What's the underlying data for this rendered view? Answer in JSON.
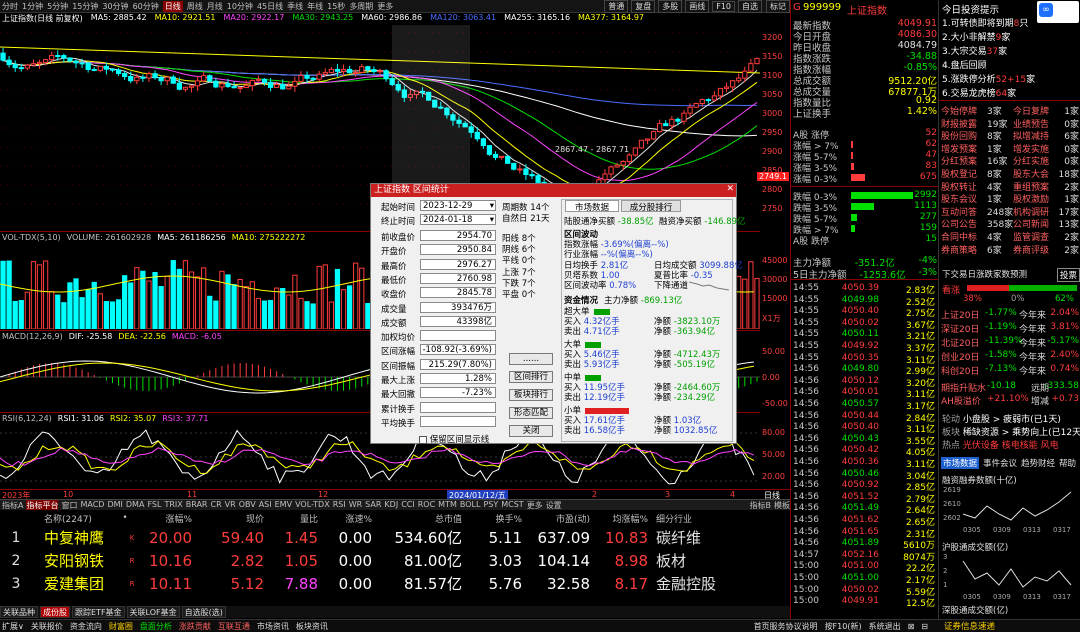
{
  "topbar": {
    "periods": [
      "分时",
      "1分钟",
      "5分钟",
      "15分钟",
      "30分钟",
      "60分钟",
      "日线",
      "周线",
      "月线",
      "10分钟",
      "45日线",
      "季线",
      "年线",
      "15秒",
      "多周期",
      "更多"
    ],
    "active_period": "日线",
    "tools": [
      "普通",
      "复盘",
      "多股",
      "画线",
      "F10",
      "自选"
    ],
    "back_label": "标记"
  },
  "chart_header": {
    "index_name": "上证指数(日线 前复权)",
    "ma": [
      {
        "label": "MA5: 2885.42",
        "color": "#ffffff"
      },
      {
        "label": "MA10: 2921.51",
        "color": "#ffff00"
      },
      {
        "label": "MA20: 2922.17",
        "color": "#ff44ff"
      },
      {
        "label": "MA30: 2943.25",
        "color": "#00e000"
      },
      {
        "label": "MA60: 2986.86",
        "color": "#ffffff"
      },
      {
        "label": "MA120: 3063.41",
        "color": "#4a6cff"
      },
      {
        "label": "MA255: 3165.16",
        "color": "#ffffff"
      },
      {
        "label": "MA377: 3164.97",
        "color": "#ffff00"
      }
    ]
  },
  "price_axis": [
    "3200",
    "3150",
    "3100",
    "3050",
    "3000",
    "2950",
    "2900",
    "2850",
    "2800",
    "2750"
  ],
  "price_current": "2749.1",
  "annotation": "2867.47 - 2867.71",
  "vol_header": {
    "name": "VOL-TDX(5,10)",
    "items": [
      {
        "label": "VOLUME: 261602928",
        "color": "#c0c0c0"
      },
      {
        "label": "MA5: 261186256",
        "color": "#ffffff"
      },
      {
        "label": "MA10: 275222272",
        "color": "#ffff00"
      }
    ]
  },
  "vol_axis": [
    "45000",
    "30000",
    "15000",
    "X1万"
  ],
  "macd_header": {
    "name": "MACD(12,26,9)",
    "items": [
      {
        "label": "DIF: -25.58",
        "color": "#ffffff"
      },
      {
        "label": "DEA: -22.56",
        "color": "#ffff00"
      },
      {
        "label": "MACD: -6.05",
        "color": "#ff44ff"
      }
    ]
  },
  "macd_axis": [
    "50.00",
    "0.00",
    "-50.00"
  ],
  "rsi_header": {
    "name": "RSI(6,12,24)",
    "items": [
      {
        "label": "RSI1: 31.06",
        "color": "#ffffff"
      },
      {
        "label": "RSI2: 35.07",
        "color": "#ffff00"
      },
      {
        "label": "RSI3: 37.71",
        "color": "#ff44ff"
      }
    ]
  },
  "rsi_axis": [
    "80.00",
    "50.00",
    "20.00"
  ],
  "time_axis": {
    "year_left": "2023年",
    "m10": "10",
    "m11": "11",
    "m12": "12",
    "cursor": "2024/01/12/五",
    "m2": "2",
    "m3": "3",
    "m4": "4",
    "mode": "日线"
  },
  "indicator_tabs": [
    "指标A",
    "指标平台",
    "窗口",
    "MACD",
    "DMI",
    "DMA",
    "FSL",
    "TRIX",
    "BRAR",
    "CR",
    "VR",
    "OBV",
    "ASI",
    "EMV",
    "VOL-TDX",
    "RSI",
    "WR",
    "SAR",
    "KDJ",
    "CCI",
    "ROC",
    "MTM",
    "BOLL",
    "PSY",
    "MCST",
    "更多",
    "设置"
  ],
  "indicator_tabs_right": [
    "指标B",
    "模板"
  ],
  "active_indicator_tab": "指标平台",
  "list_header": [
    "名称(2247)",
    "•",
    "涨幅%",
    "现价",
    "量比",
    "涨速%",
    "总市值",
    "换手%",
    "市盈(动)",
    "均涨幅%",
    "细分行业"
  ],
  "stocks": [
    {
      "rank": "1",
      "name": "中复神鹰",
      "flag": "K",
      "chg": "20.00",
      "price": "59.40",
      "vr": "1.45",
      "speed": "0.00",
      "mcap": "534.60亿",
      "turn": "5.11",
      "pe": "637.09",
      "avg": "10.83",
      "ind": "碳纤维"
    },
    {
      "rank": "2",
      "name": "安阳钢铁",
      "flag": "R",
      "chg": "10.16",
      "price": "2.82",
      "vr": "1.05",
      "speed": "0.00",
      "mcap": "81.00亿",
      "turn": "3.03",
      "pe": "104.14",
      "avg": "8.98",
      "ind": "板材"
    },
    {
      "rank": "3",
      "name": "爱建集团",
      "flag": "R",
      "chg": "10.11",
      "price": "5.12",
      "vr": "7.88",
      "speed": "0.00",
      "mcap": "81.57亿",
      "turn": "5.76",
      "pe": "32.58",
      "avg": "8.17",
      "ind": "金融控股"
    }
  ],
  "block_tabs": [
    "关联品种",
    "成份股",
    "跟踪ETF基金",
    "关联LOF基金",
    "自选股(选)"
  ],
  "active_block_tab": "成份股",
  "statusbar": [
    "扩展∨",
    "关联报价",
    "资金流向",
    "财富圈",
    "盘面分析",
    "涨跌贡献",
    "互联互通",
    "市场资讯",
    "板块资讯"
  ],
  "statusbar_right": [
    "首页服务协议说明",
    "按F10(新)",
    "系统退出",
    "⊠",
    "⊟"
  ],
  "quote": {
    "code": "999999",
    "name": "上证指数",
    "rows": [
      {
        "k": "最新指数",
        "v": "4049.91",
        "c": "#ff3c3c"
      },
      {
        "k": "今日开盘",
        "v": "4086.30",
        "c": "#ff3c3c"
      },
      {
        "k": "昨日收盘",
        "v": "4084.79",
        "c": "#e0e0e0"
      },
      {
        "k": "指数涨跌",
        "v": "-34.88",
        "c": "#00e000"
      },
      {
        "k": "指数涨幅",
        "v": "-0.85%",
        "c": "#00e000"
      },
      {
        "k": "总成交额",
        "v": "9512.20亿",
        "c": "#ffff00"
      },
      {
        "k": "总成交量",
        "v": "67877.1万",
        "c": "#ffff00"
      },
      {
        "k": "指数量比",
        "v": "0.92",
        "c": "#ffff00"
      },
      {
        "k": "上证换手",
        "v": "1.42%",
        "c": "#ffff00"
      }
    ],
    "updown": [
      {
        "k": "A股 涨停",
        "v": "52",
        "c": "#ff3c3c",
        "bw": 0
      },
      {
        "k": "涨幅 > 7%",
        "v": "62",
        "c": "#ff3c3c",
        "bw": 2
      },
      {
        "k": "涨幅 5-7%",
        "v": "47",
        "c": "#ff3c3c",
        "bw": 2
      },
      {
        "k": "涨幅 3-5%",
        "v": "83",
        "c": "#ff3c3c",
        "bw": 3
      },
      {
        "k": "涨幅 0-3%",
        "v": "675",
        "c": "#ff3c3c",
        "bw": 14
      },
      {
        "k": "跌幅 0-3%",
        "v": "2992",
        "c": "#00e000",
        "bw": 62
      },
      {
        "k": "跌幅 3-5%",
        "v": "1113",
        "c": "#00e000",
        "bw": 23
      },
      {
        "k": "跌幅 5-7%",
        "v": "277",
        "c": "#00e000",
        "bw": 6
      },
      {
        "k": "跌幅 > 7%",
        "v": "159",
        "c": "#00e000",
        "bw": 4
      },
      {
        "k": "A股 跌停",
        "v": "15",
        "c": "#00e000",
        "bw": 0
      }
    ],
    "flow": [
      {
        "k": "主力净额",
        "v": "-351.2亿",
        "p": "-4%"
      },
      {
        "k": "5日主力净额",
        "v": "-1253.6亿",
        "p": "-3%"
      }
    ],
    "ticks": [
      {
        "t": "14:55",
        "p": "4050.39",
        "v": "2.83亿"
      },
      {
        "t": "14:55",
        "p": "4049.98",
        "v": "2.52亿"
      },
      {
        "t": "14:55",
        "p": "4050.40",
        "v": "2.75亿"
      },
      {
        "t": "14:55",
        "p": "4050.02",
        "v": "3.67亿"
      },
      {
        "t": "14:55",
        "p": "4050.11",
        "v": "3.21亿"
      },
      {
        "t": "14:55",
        "p": "4049.92",
        "v": "3.37亿"
      },
      {
        "t": "14:55",
        "p": "4050.35",
        "v": "3.11亿"
      },
      {
        "t": "14:56",
        "p": "4049.80",
        "v": "2.99亿"
      },
      {
        "t": "14:56",
        "p": "4050.12",
        "v": "3.20亿"
      },
      {
        "t": "14:56",
        "p": "4050.01",
        "v": "3.11亿"
      },
      {
        "t": "14:56",
        "p": "4050.57",
        "v": "3.17亿"
      },
      {
        "t": "14:56",
        "p": "4050.44",
        "v": "2.84亿"
      },
      {
        "t": "14:56",
        "p": "4050.40",
        "v": "3.11亿"
      },
      {
        "t": "14:56",
        "p": "4050.43",
        "v": "3.55亿"
      },
      {
        "t": "14:56",
        "p": "4050.42",
        "v": "4.05亿"
      },
      {
        "t": "14:56",
        "p": "4050.36",
        "v": "3.11亿"
      },
      {
        "t": "14:56",
        "p": "4050.46",
        "v": "3.04亿"
      },
      {
        "t": "14:56",
        "p": "4050.92",
        "v": "2.85亿"
      },
      {
        "t": "14:56",
        "p": "4051.52",
        "v": "2.79亿"
      },
      {
        "t": "14:56",
        "p": "4051.49",
        "v": "2.64亿"
      },
      {
        "t": "14:56",
        "p": "4051.62",
        "v": "2.65亿"
      },
      {
        "t": "14:56",
        "p": "4051.65",
        "v": "2.31亿"
      },
      {
        "t": "14:56",
        "p": "4051.89",
        "v": "5610万"
      },
      {
        "t": "14:57",
        "p": "4052.16",
        "v": "8074万"
      },
      {
        "t": "15:00",
        "p": "4051.00",
        "v": "22.2亿"
      },
      {
        "t": "15:00",
        "p": "4051.00",
        "v": "2.17亿"
      },
      {
        "t": "15:00",
        "p": "4050.02",
        "v": "5.59亿"
      },
      {
        "t": "15:00",
        "p": "4049.91",
        "v": "12.5亿"
      }
    ]
  },
  "far_right": {
    "title": "今日投资提示",
    "tips": [
      {
        "n": "1.",
        "t": "可转债即将到期",
        "v": "8",
        "s": "只"
      },
      {
        "n": "2.",
        "t": "大小非解禁",
        "v": "9",
        "s": "家"
      },
      {
        "n": "3.",
        "t": "大宗交易",
        "v": "37",
        "s": "家"
      },
      {
        "n": "4.",
        "t": "盘后回顾",
        "v": "",
        "s": ""
      },
      {
        "n": "5.",
        "t": "涨跌停分析",
        "v": "52+15",
        "s": "家"
      },
      {
        "n": "6.",
        "t": "交易龙虎榜",
        "v": "64",
        "s": "家"
      }
    ],
    "events": [
      [
        "今始停牌",
        "3家",
        "今日复牌",
        "1家"
      ],
      [
        "财报披露",
        "19家",
        "业绩预告",
        "0家"
      ],
      [
        "股份回购",
        "8家",
        "拟增减持",
        "6家"
      ],
      [
        "增发预案",
        "1家",
        "增发实施",
        "0家"
      ],
      [
        "分红预案",
        "16家",
        "分红实施",
        "0家"
      ],
      [
        "股权登记",
        "8家",
        "股东大会",
        "18家"
      ],
      [
        "股权转让",
        "4家",
        "重组预案",
        "2家"
      ],
      [
        "股东会议",
        "1家",
        "股权激励",
        "1家"
      ],
      [
        "互动问答",
        "248家",
        "机构调研",
        "17家"
      ],
      [
        "公司公告",
        "358家",
        "公司新闻",
        "13家"
      ],
      [
        "合同中标",
        "4家",
        "监管调查",
        "2家"
      ],
      [
        "券商策略",
        "6家",
        "券商评级",
        "2家"
      ]
    ],
    "board_title": "下交易日涨跌家数预测",
    "board_btn": "投票",
    "bull_label": "看涨",
    "bull_pct": "38%",
    "flat_pct": "0%",
    "bear_pct": "62%",
    "connect": [
      [
        "上证20日",
        "-1.77%",
        "今年来",
        "2.04%"
      ],
      [
        "深证20日",
        "-1.19%",
        "今年来",
        "3.81%"
      ],
      [
        "北证20日",
        "-11.39%",
        "今年来",
        "-5.17%"
      ],
      [
        "创业20日",
        "-1.58%",
        "今年来",
        "2.40%"
      ],
      [
        "科创20日",
        "-7.13%",
        "今年来",
        "0.74%"
      ]
    ],
    "futures": [
      {
        "a": "期指升贴水",
        "b": "-10.18",
        "c": "远期",
        "d": "-333.58"
      },
      {
        "a": "AH股溢价",
        "b": "+21.10%",
        "c": "增减",
        "d": "+0.73"
      }
    ],
    "hot1": {
      "k": "轮动",
      "v": "小盘股 > 疲弱市(已1天)"
    },
    "hot2": {
      "k": "板块",
      "v": "稀缺资源 > 乘势向上(已12天)"
    },
    "hot3": {
      "k": "热点",
      "v": "光伏设备 核电核能 风电"
    },
    "tabs": [
      "市场数据",
      "事件会议",
      "趋势财经",
      "帮助"
    ],
    "chart1": {
      "title": "融资融券数额(十亿)",
      "y": [
        "2619",
        "2610",
        "2602"
      ],
      "x": [
        "0305",
        "0309",
        "0313",
        "0317"
      ]
    },
    "chart2": {
      "title": "沪股通成交额(亿)",
      "y": [
        "3",
        "2",
        "1"
      ],
      "x": [
        "0305",
        "0309",
        "0313",
        "0317"
      ]
    },
    "chart3_title": "深股通成交额(亿)",
    "bottom_label": "证券信息速递"
  },
  "dialog": {
    "title": "上证指数 区间统计",
    "start_label": "起始时间",
    "start": "2023-12-29",
    "end_label": "终止时间",
    "end": "2024-01-18",
    "fields": [
      {
        "k": "前收盘价",
        "v": "2954.70"
      },
      {
        "k": "开盘价",
        "v": "2950.84"
      },
      {
        "k": "最高价",
        "v": "2976.27"
      },
      {
        "k": "最低价",
        "v": "2760.98"
      },
      {
        "k": "收盘价",
        "v": "2845.78"
      },
      {
        "k": "成交量",
        "v": "393476万"
      },
      {
        "k": "成交额",
        "v": "43398亿"
      },
      {
        "k": "加权均价",
        "v": ""
      },
      {
        "k": "区间涨幅",
        "v": "-108.92(-3.69%)"
      },
      {
        "k": "区间振幅",
        "v": "215.29(7.80%)"
      },
      {
        "k": "最大上涨",
        "v": "1.28%"
      },
      {
        "k": "最大回撤",
        "v": "-7.23%"
      },
      {
        "k": "累计换手",
        "v": ""
      },
      {
        "k": "平均换手",
        "v": ""
      }
    ],
    "period_label": "周期数",
    "period": "14个",
    "natural_label": "自然日",
    "natural": "21天",
    "counts": [
      {
        "k": "阳线",
        "v": "8个"
      },
      {
        "k": "阴线",
        "v": "6个"
      },
      {
        "k": "平线",
        "v": "0个"
      },
      {
        "k": "上涨",
        "v": "7个"
      },
      {
        "k": "下跌",
        "v": "7个"
      },
      {
        "k": "平盘",
        "v": "0个"
      }
    ],
    "buttons": [
      "......",
      "区间排行",
      "板块排行",
      "形态匹配",
      "关闭"
    ],
    "checkbox": "保留区间显示线",
    "tab_market": "市场数据",
    "tab_rank": "成分股排行",
    "net": {
      "a": "陆股通净买额",
      "b": "-38.85亿",
      "c": "融资净买额",
      "d": "-146.89亿"
    },
    "fluct_title": "区间波动",
    "fluct": [
      {
        "k": "指数涨幅",
        "v": "-3.69%(偏离--%)"
      },
      {
        "k": "行业涨幅",
        "v": "--%(偏离--%)"
      }
    ],
    "turn": {
      "a": "日均换手",
      "b": "2.81亿",
      "c": "日均成交额",
      "d": "3099.88亿"
    },
    "ratio": {
      "a": "贝塔系数",
      "b": "1.00",
      "c": "夏普比率",
      "d": "-0.35"
    },
    "vol": {
      "a": "区间波动率",
      "b": "0.78%",
      "c": "下降通道"
    },
    "fund_title": "资金情况",
    "fund_main": {
      "k": "主力净额",
      "v": "-869.13亿"
    },
    "groups": [
      {
        "name": "超大单",
        "buy": "4.32亿手",
        "sell": "4.71亿手",
        "net1": "-3823.10万",
        "net2": "-363.94亿",
        "bc": "#00a000"
      },
      {
        "name": "大单",
        "buy": "5.46亿手",
        "sell": "5.93亿手",
        "net1": "-4712.43万",
        "net2": "-505.19亿",
        "bc": "#00a000"
      },
      {
        "name": "中单",
        "buy": "11.95亿手",
        "sell": "12.19亿手",
        "net1": "-2464.60万",
        "net2": "-234.29亿",
        "bc": "#00a000"
      },
      {
        "name": "小单",
        "buy": "17.61亿手",
        "sell": "16.58亿手",
        "net1": "1.03亿",
        "net2": "1032.85亿",
        "bc": "#e02020"
      }
    ],
    "buy_label": "买入",
    "sell_label": "卖出",
    "net_label": "净额"
  }
}
